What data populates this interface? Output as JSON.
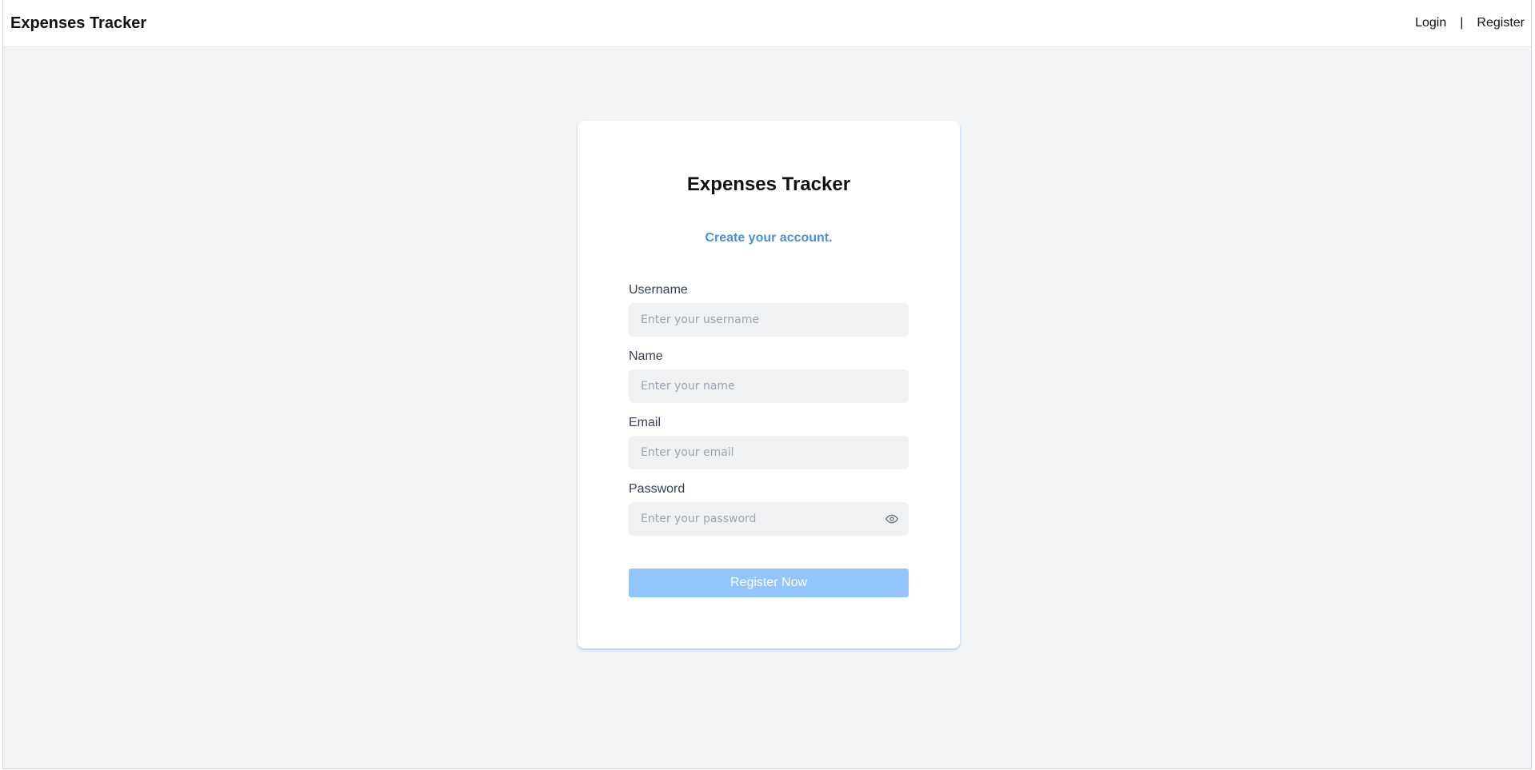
{
  "navbar": {
    "brand": "Expenses Tracker",
    "login_label": "Login",
    "separator": "|",
    "register_label": "Register"
  },
  "card": {
    "title": "Expenses Tracker",
    "subtitle": "Create your account.",
    "fields": [
      {
        "label": "Username",
        "placeholder": "Enter your username",
        "value": ""
      },
      {
        "label": "Name",
        "placeholder": "Enter your name",
        "value": ""
      },
      {
        "label": "Email",
        "placeholder": "Enter your email",
        "value": ""
      },
      {
        "label": "Password",
        "placeholder": "Enter your password",
        "value": "",
        "icon": "eye-icon"
      }
    ],
    "submit_label": "Register Now"
  },
  "colors": {
    "page_background": "#f3f4f6",
    "subtitle": "#4a90d9",
    "button": "#93c5fd",
    "input_background": "#f0f1f3"
  }
}
